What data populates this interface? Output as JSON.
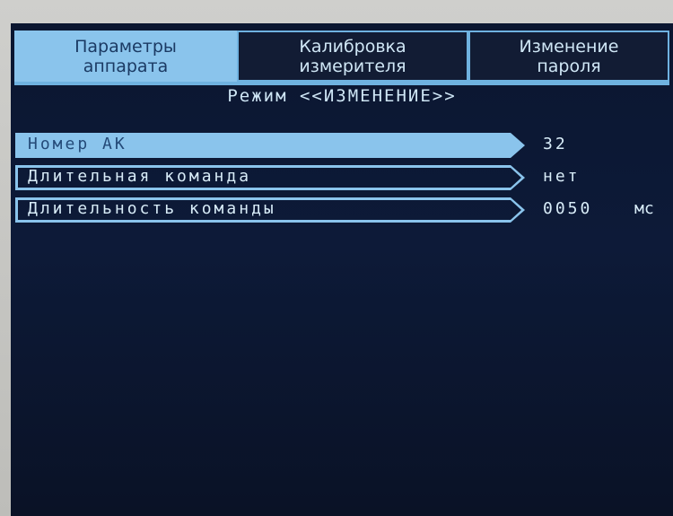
{
  "tabs": [
    {
      "label": "Параметры\nаппарата",
      "active": true
    },
    {
      "label": "Калибровка\nизмерителя",
      "active": false
    },
    {
      "label": "Изменение\nпароля",
      "active": false
    }
  ],
  "mode_line": "Режим <<ИЗМЕНЕНИЕ>>",
  "params": [
    {
      "label": "Номер АК",
      "value": "32",
      "unit": ""
    },
    {
      "label": "Длительная команда",
      "value": "нет",
      "unit": ""
    },
    {
      "label": "Длительность команды",
      "value": "0050",
      "unit": "мс"
    }
  ],
  "colors": {
    "screen_bg": "#0c1834",
    "accent": "#8ac4ec",
    "text": "#d8ecf8"
  }
}
